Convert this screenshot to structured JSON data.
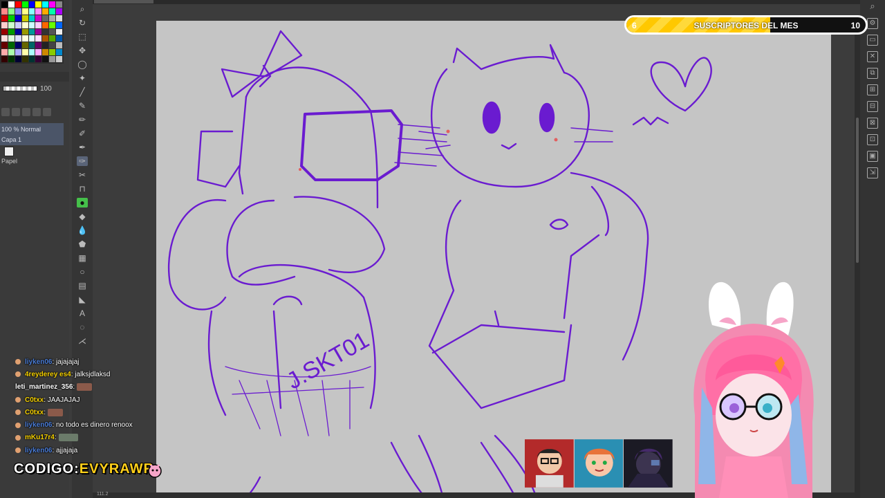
{
  "layers": {
    "opacity_value": "100",
    "blend_mode": "100 % Normal",
    "layer_name": "Capa 1",
    "paper_name": "Papel"
  },
  "subscriber_goal": {
    "current": "6",
    "label": "SUSCRIPTORES DEL MES",
    "target": "10",
    "progress": 0.6
  },
  "chat": {
    "messages": [
      {
        "user": "liyken06",
        "text": ": jajajajaj",
        "user_color": "#4a7cd6"
      },
      {
        "user": "4reyderey es4",
        "text": ": jalksjdlaksd",
        "user_color": "#f5d000"
      },
      {
        "user": "leti_martinez_356",
        "text": ":",
        "user_color": "#ffffff"
      },
      {
        "user": "C0txx",
        "text": ": JAAJAJAJ",
        "user_color": "#f5d000"
      },
      {
        "user": "C0txx",
        "text": ":",
        "user_color": "#f5d000"
      },
      {
        "user": "liyken06",
        "text": ": no todo es dinero renoox",
        "user_color": "#4a7cd6"
      },
      {
        "user": "mKu17r4",
        "text": ":",
        "user_color": "#f5d000"
      },
      {
        "user": "liyken06",
        "text": ": ajjajaja",
        "user_color": "#4a7cd6"
      }
    ]
  },
  "promo": {
    "prefix": "CODIGO:",
    "code": "EVYRAWR"
  },
  "canvas": {
    "sketch_text": "J.SKT01",
    "ink_color": "#6a1bd0"
  },
  "status": {
    "bottom_number": "111.2"
  }
}
